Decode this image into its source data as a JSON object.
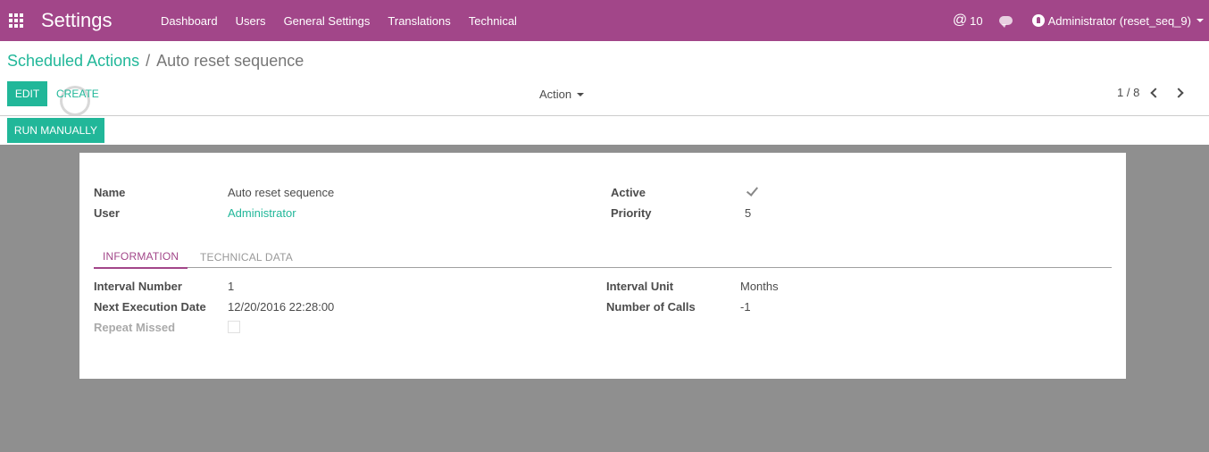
{
  "navbar": {
    "app_title": "Settings",
    "menu": [
      "Dashboard",
      "Users",
      "General Settings",
      "Translations",
      "Technical"
    ],
    "mention_count": "10",
    "user_label": "Administrator (reset_seq_9)",
    "color": "#a24689"
  },
  "breadcrumb": {
    "parent": "Scheduled Actions",
    "separator": "/",
    "current": "Auto reset sequence"
  },
  "buttons": {
    "edit": "EDIT",
    "create": "CREATE",
    "action": "Action",
    "run_manually": "RUN MANUALLY",
    "accent": "#21b799"
  },
  "pager": {
    "value": "1 / 8"
  },
  "form": {
    "name_label": "Name",
    "name_value": "Auto reset sequence",
    "user_label": "User",
    "user_value": "Administrator",
    "active_label": "Active",
    "active_value": true,
    "priority_label": "Priority",
    "priority_value": "5",
    "tabs": [
      "INFORMATION",
      "TECHNICAL DATA"
    ],
    "active_tab": "INFORMATION",
    "interval_number_label": "Interval Number",
    "interval_number_value": "1",
    "next_execution_label": "Next Execution Date",
    "next_execution_value": "12/20/2016 22:28:00",
    "repeat_missed_label": "Repeat Missed",
    "repeat_missed_value": false,
    "interval_unit_label": "Interval Unit",
    "interval_unit_value": "Months",
    "number_of_calls_label": "Number of Calls",
    "number_of_calls_value": "-1"
  }
}
